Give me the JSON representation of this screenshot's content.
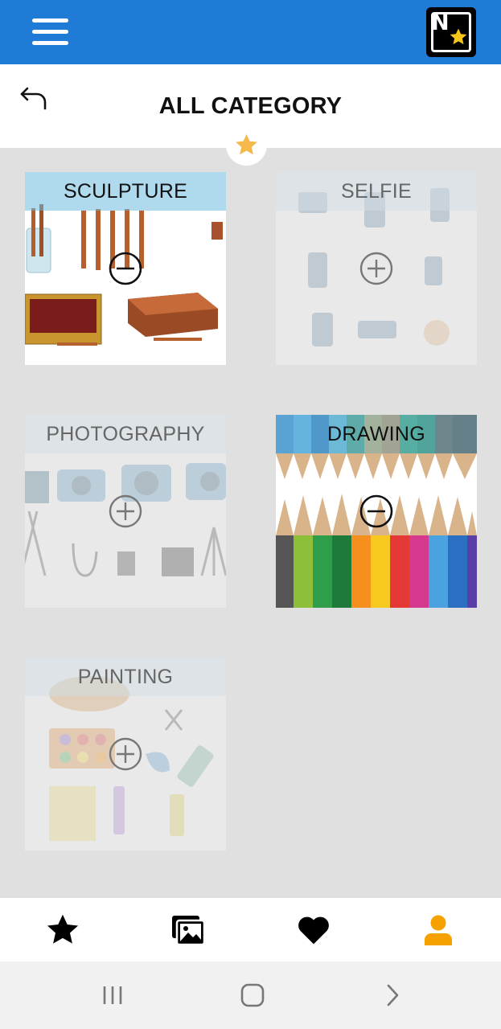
{
  "header": {
    "menu_icon": "hamburger-menu-icon",
    "logo_letter": "N",
    "logo_icon": "app-logo-star-icon",
    "bar_color": "#1f7bd6"
  },
  "page": {
    "title": "ALL CATEGORY",
    "back_icon": "back-arrow-icon",
    "badge_icon": "star-icon",
    "accent_color": "#f4a623"
  },
  "categories": [
    {
      "label": "SCULPTURE",
      "state": "selected",
      "toggle_icon": "minus-circle-icon"
    },
    {
      "label": "SELFIE",
      "state": "unselected",
      "toggle_icon": "plus-circle-icon"
    },
    {
      "label": "PHOTOGRAPHY",
      "state": "unselected",
      "toggle_icon": "plus-circle-icon"
    },
    {
      "label": "DRAWING",
      "state": "selected",
      "toggle_icon": "minus-circle-icon"
    },
    {
      "label": "PAINTING",
      "state": "unselected",
      "toggle_icon": "plus-circle-icon"
    }
  ],
  "bottom_nav": [
    {
      "icon": "star-icon",
      "active": false
    },
    {
      "icon": "gallery-icon",
      "active": false
    },
    {
      "icon": "heart-icon",
      "active": false
    },
    {
      "icon": "profile-icon",
      "active": true
    }
  ],
  "system_nav": [
    {
      "icon": "recent-apps-icon"
    },
    {
      "icon": "home-icon"
    },
    {
      "icon": "back-chevron-icon"
    }
  ]
}
